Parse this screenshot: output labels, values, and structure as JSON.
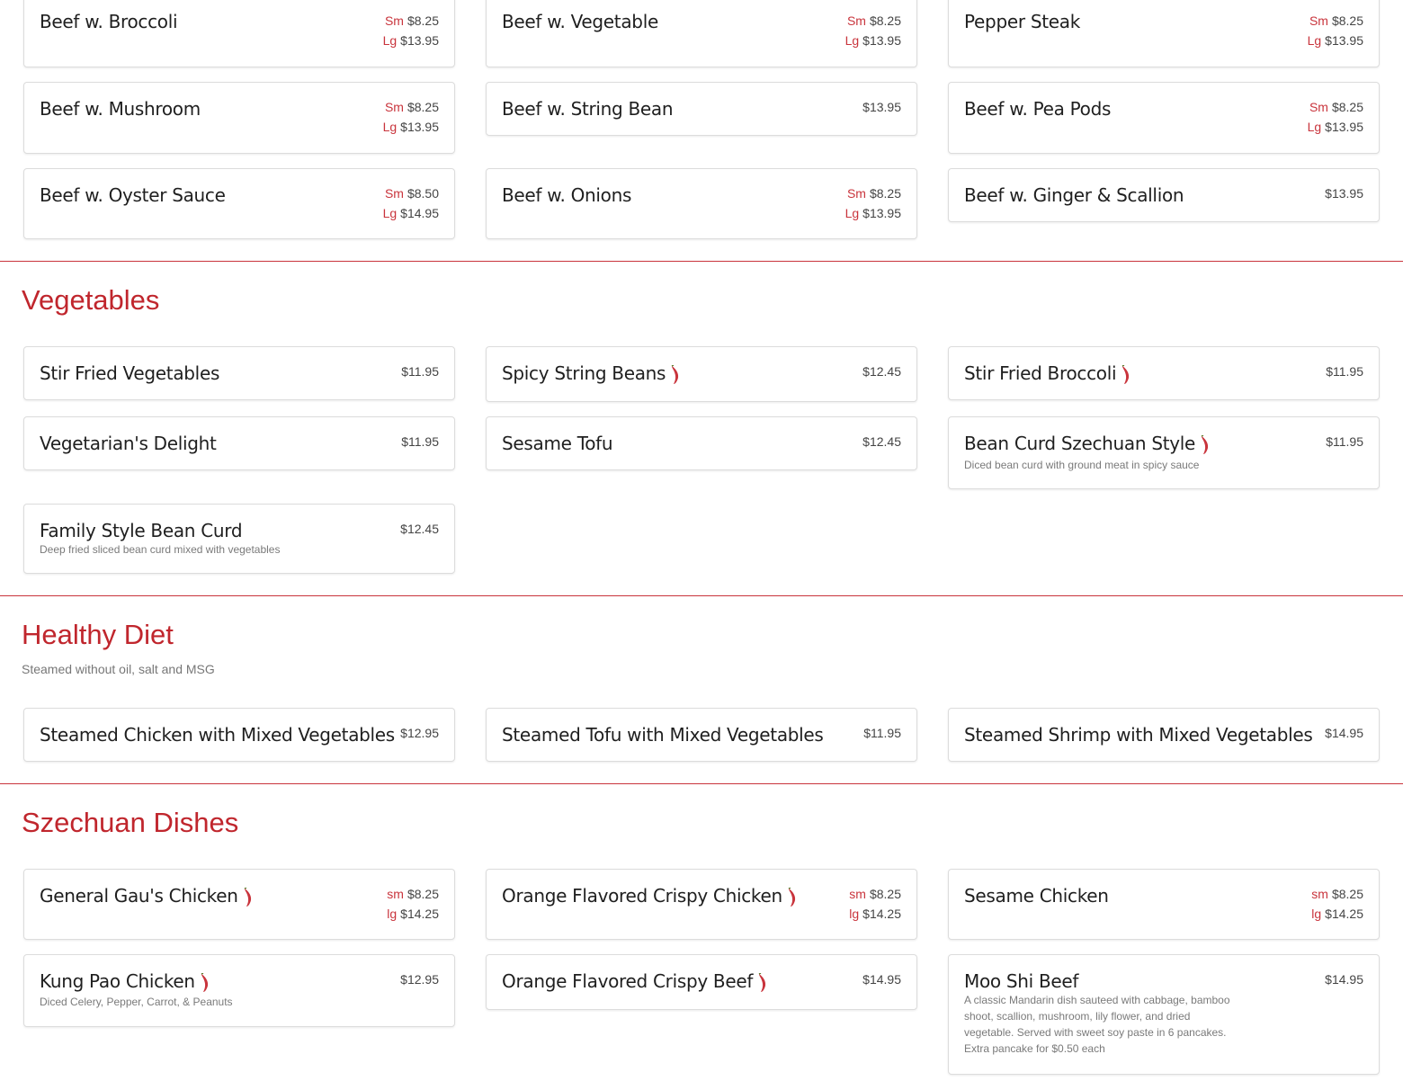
{
  "beef": [
    {
      "name": "Beef w. Broccoli",
      "sm": "$8.25",
      "lg": "$13.95"
    },
    {
      "name": "Beef w. Vegetable",
      "sm": "$8.25",
      "lg": "$13.95"
    },
    {
      "name": "Pepper Steak",
      "sm": "$8.25",
      "lg": "$13.95"
    },
    {
      "name": "Beef w. Mushroom",
      "sm": "$8.25",
      "lg": "$13.95"
    },
    {
      "name": "Beef w. String Bean",
      "price": "$13.95"
    },
    {
      "name": "Beef w. Pea Pods",
      "sm": "$8.25",
      "lg": "$13.95"
    },
    {
      "name": "Beef w. Oyster Sauce",
      "sm": "$8.50",
      "lg": "$14.95"
    },
    {
      "name": "Beef w. Onions",
      "sm": "$8.25",
      "lg": "$13.95"
    },
    {
      "name": "Beef w. Ginger & Scallion",
      "price": "$13.95"
    }
  ],
  "size_labels": {
    "sm_cap": "Sm",
    "lg_cap": "Lg",
    "sm_low": "sm",
    "lg_low": "lg"
  },
  "vegetables": {
    "title": "Vegetables",
    "items": [
      {
        "name": "Stir Fried Vegetables",
        "price": "$11.95"
      },
      {
        "name": "Spicy String Beans",
        "price": "$12.45",
        "spicy": true
      },
      {
        "name": "Stir Fried Broccoli",
        "price": "$11.95",
        "spicy": true
      },
      {
        "name": "Vegetarian's Delight",
        "price": "$11.95"
      },
      {
        "name": "Sesame Tofu",
        "price": "$12.45"
      },
      {
        "name": "Bean Curd Szechuan Style",
        "price": "$11.95",
        "spicy": true,
        "desc": "Diced bean curd with ground meat in spicy sauce"
      },
      {
        "name": "Family Style Bean Curd",
        "price": "$12.45",
        "desc": "Deep fried sliced bean curd mixed with vegetables"
      }
    ]
  },
  "healthy": {
    "title": "Healthy Diet",
    "note": "Steamed without oil, salt and MSG",
    "items": [
      {
        "name": "Steamed Chicken with Mixed Vegetables",
        "price": "$12.95"
      },
      {
        "name": "Steamed Tofu with Mixed Vegetables",
        "price": "$11.95"
      },
      {
        "name": "Steamed Shrimp with Mixed Vegetables",
        "price": "$14.95"
      }
    ]
  },
  "szechuan": {
    "title": "Szechuan Dishes",
    "items": [
      {
        "name": "General Gau's Chicken",
        "spicy": true,
        "sm": "$8.25",
        "lg": "$14.25"
      },
      {
        "name": "Orange Flavored Crispy Chicken",
        "spicy": true,
        "sm": "$8.25",
        "lg": "$14.25"
      },
      {
        "name": "Sesame Chicken",
        "sm": "$8.25",
        "lg": "$14.25"
      },
      {
        "name": "Kung Pao Chicken",
        "spicy": true,
        "price": "$12.95",
        "desc": "Diced Celery, Pepper, Carrot, & Peanuts"
      },
      {
        "name": "Orange Flavored Crispy Beef",
        "spicy": true,
        "price": "$14.95"
      },
      {
        "name": "Moo Shi Beef",
        "price": "$14.95",
        "desc": "A classic Mandarin dish sauteed with cabbage, bamboo shoot, scallion, mushroom, lily flower, and dried vegetable. Served with sweet soy paste in 6 pancakes. Extra pancake for $0.50 each"
      }
    ]
  },
  "colors": {
    "accent": "#c9343c",
    "heading": "#c0262d",
    "border": "#dcdcdc"
  },
  "icons": {
    "spicy": "chili-pepper-icon"
  }
}
